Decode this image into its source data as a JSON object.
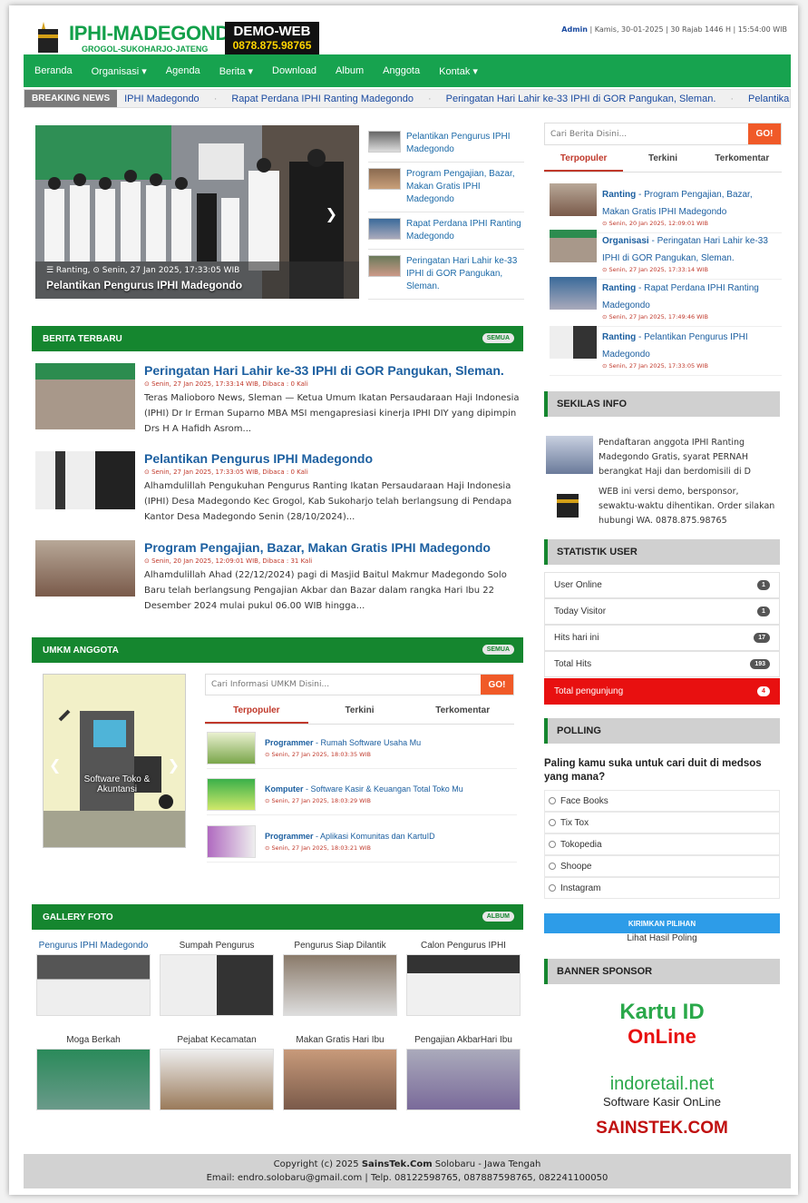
{
  "header": {
    "site_title": "IPHI-MADEGONDO",
    "site_subtitle": "GROGOL-SUKOHARJO-JATENG",
    "demo_line1": "DEMO-WEB",
    "demo_line2": "0878.875.98765",
    "user": "Admin",
    "datetime": " | Kamis, 30-01-2025 | 30 Rajab 1446 H | 15:54:00 WIB"
  },
  "nav": {
    "items": [
      "Beranda",
      "Organisasi ▾",
      "Agenda",
      "Berita ▾",
      "Download",
      "Album",
      "Anggota",
      "Kontak ▾"
    ]
  },
  "breaking": {
    "label": "BREAKING NEWS",
    "items": [
      "IPHI Madegondo",
      "Rapat Perdana IPHI Ranting Madegondo",
      "Peringatan Hari Lahir ke-33 IPHI di GOR Pangukan, Sleman.",
      "Pelantikan Pengurus IPHI Madegondo"
    ]
  },
  "slider": {
    "meta": "☰ Ranting, ⊙ Senin, 27 Jan 2025, 17:33:05 WIB",
    "title": "Pelantikan Pengurus IPHI Madegondo"
  },
  "side_list": [
    "Pelantikan Pengurus IPHI Madegondo",
    "Program Pengajian, Bazar, Makan Gratis IPHI Madegondo",
    "Rapat Perdana IPHI Ranting Madegondo",
    "Peringatan Hari Lahir ke-33 IPHI di GOR Pangukan, Sleman."
  ],
  "berita": {
    "title": "BERITA TERBARU",
    "badge": "SEMUA",
    "items": [
      {
        "title": "Peringatan Hari Lahir ke-33 IPHI di GOR Pangukan, Sleman.",
        "meta": "⊙ Senin, 27 Jan 2025, 17:33:14 WIB, Dibaca : 0 Kali",
        "excerpt": "Teras Malioboro News, Sleman — Ketua Umum Ikatan Persaudaraan Haji Indonesia (IPHI) Dr Ir Erman Suparno MBA MSI mengapresiasi kinerja IPHI DIY yang dipimpin Drs H A Hafidh Asrom..."
      },
      {
        "title": "Pelantikan Pengurus IPHI Madegondo",
        "meta": "⊙ Senin, 27 Jan 2025, 17:33:05 WIB, Dibaca : 0 Kali",
        "excerpt": "Alhamdulillah Pengukuhan Pengurus Ranting Ikatan Persaudaraan Haji Indonesia (IPHI) Desa Madegondo Kec Grogol, Kab Sukoharjo telah berlangsung di Pendapa Kantor Desa Madegondo Senin (28/10/2024)..."
      },
      {
        "title": "Program Pengajian, Bazar, Makan Gratis IPHI Madegondo",
        "meta": "⊙ Senin, 20 Jan 2025, 12:09:01 WIB, Dibaca : 31 Kali",
        "excerpt": "Alhamdulillah Ahad (22/12/2024) pagi di Masjid Baitul Makmur Madegondo Solo Baru telah berlangsung Pengajian Akbar dan Bazar dalam rangka Hari Ibu 22 Desember 2024 mulai pukul 06.00 WIB hingga..."
      }
    ]
  },
  "umkm": {
    "title": "UMKM ANGGOTA",
    "badge": "SEMUA",
    "slide_caption": "Software Toko & Akuntansi",
    "search_placeholder": "Cari Informasi UMKM Disini...",
    "go": "GO!",
    "tabs": [
      "Terpopuler",
      "Terkini",
      "Terkomentar"
    ],
    "items": [
      {
        "cat": "Programmer",
        "title": " - Rumah Software Usaha Mu",
        "meta": "⊙ Senin, 27 Jan 2025, 18:03:35 WIB"
      },
      {
        "cat": "Komputer",
        "title": " - Software Kasir & Keuangan Total Toko Mu",
        "meta": "⊙ Senin, 27 Jan 2025, 18:03:29 WIB"
      },
      {
        "cat": "Programmer",
        "title": " - Aplikasi Komunitas dan KartuID",
        "meta": "⊙ Senin, 27 Jan 2025, 18:03:21 WIB"
      }
    ]
  },
  "gallery": {
    "title": "GALLERY FOTO",
    "badge": "ALBUM",
    "items": [
      "Pengurus IPHI Madegondo",
      "Sumpah Pengurus",
      "Pengurus Siap Dilantik",
      "Calon Pengurus IPHI",
      "Moga Berkah",
      "Pejabat Kecamatan",
      "Makan Gratis Hari Ibu",
      "Pengajian AkbarHari Ibu"
    ]
  },
  "right": {
    "search_placeholder": "Cari Berita Disini...",
    "go": "GO!",
    "tabs": [
      "Terpopuler",
      "Terkini",
      "Terkomentar"
    ],
    "items": [
      {
        "cat": "Ranting",
        "title": " - Program Pengajian, Bazar, Makan Gratis IPHI Madegondo",
        "meta": "⊙ Senin, 20 Jan 2025, 12:09:01 WIB"
      },
      {
        "cat": "Organisasi",
        "title": " - Peringatan Hari Lahir ke-33 IPHI di GOR Pangukan, Sleman.",
        "meta": "⊙ Senin, 27 Jan 2025, 17:33:14 WIB"
      },
      {
        "cat": "Ranting",
        "title": " - Rapat Perdana IPHI Ranting Madegondo",
        "meta": "⊙ Senin, 27 Jan 2025, 17:49:46 WIB"
      },
      {
        "cat": "Ranting",
        "title": " - Pelantikan Pengurus IPHI Madegondo",
        "meta": "⊙ Senin, 27 Jan 2025, 17:33:05 WIB"
      }
    ],
    "sekilas_title": "SEKILAS INFO",
    "sekilas": [
      "Pendaftaran anggota IPHI Ranting Madegondo Gratis, syarat PERNAH berangkat Haji dan berdomisili di D",
      "WEB ini versi demo, bersponsor, sewaktu-waktu dihentikan. Order silakan hubungi WA. 0878.875.98765"
    ],
    "stat_title": "STATISTIK USER",
    "stats": [
      {
        "label": "User Online",
        "value": "1"
      },
      {
        "label": "Today Visitor",
        "value": "1"
      },
      {
        "label": "Hits hari ini",
        "value": "17"
      },
      {
        "label": "Total Hits",
        "value": "193"
      },
      {
        "label": "Total pengunjung",
        "value": "4"
      }
    ],
    "poll_title": "POLLING",
    "poll_question": "Paling kamu suka untuk cari duit di medsos yang mana?",
    "poll_options": [
      "Face Books",
      "Tix Tox",
      "Tokopedia",
      "Shoope",
      "Instagram"
    ],
    "poll_button": "KIRIMKAN PILIHAN",
    "poll_link": "Lihat Hasil Poling",
    "banner_title": "BANNER SPONSOR",
    "sponsor1_a": "Kartu ID",
    "sponsor1_b": "OnLine",
    "sponsor2_a": "indoretail.net",
    "sponsor2_b": "Software Kasir OnLine",
    "sponsor3": "SAINSTEK.COM"
  },
  "footer": {
    "line1_a": "Copyright (c) 2025 ",
    "line1_b": "SainsTek.Com",
    "line1_c": " Solobaru - Jawa Tengah",
    "line2": "Email: endro.solobaru@gmail.com | Telp. 08122598765, 087887598765, 082241100050"
  },
  "colors": {
    "brand": "#17a34f",
    "section": "#15862f",
    "link": "#1c5fa0",
    "accent": "#f05a28",
    "alert": "#e81010"
  }
}
